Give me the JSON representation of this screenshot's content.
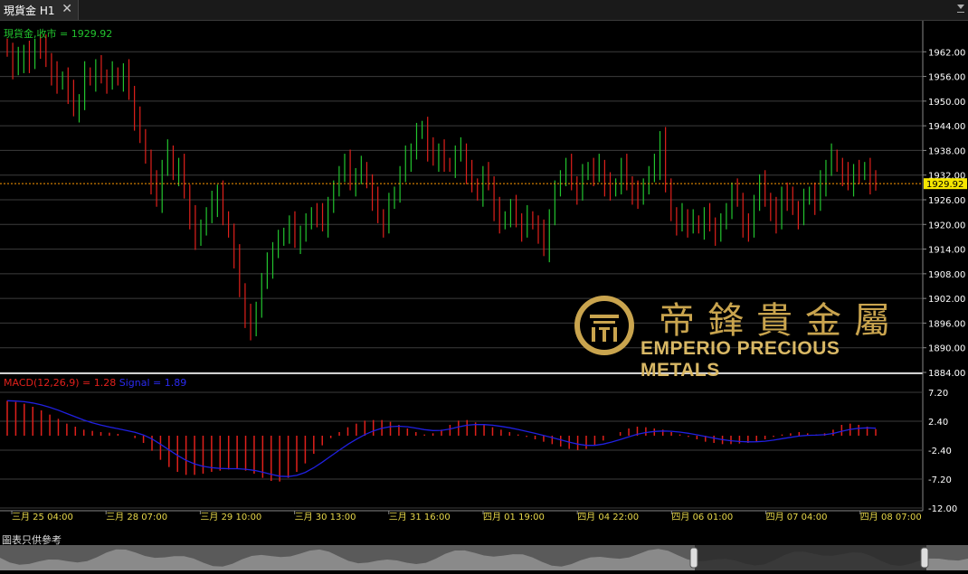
{
  "tab": {
    "title": "現貨金 H1",
    "close": "✕"
  },
  "price_label": "現貨金,收市 = 1929.92",
  "current_price": "1929.92",
  "macd_label": {
    "name": "MACD(12,26,9) = 1.28",
    "signal": "Signal = 1.89"
  },
  "price_axis": [
    "1962.00",
    "1956.00",
    "1950.00",
    "1944.00",
    "1938.00",
    "1932.00",
    "1926.00",
    "1920.00",
    "1914.00",
    "1908.00",
    "1902.00",
    "1896.00",
    "1890.00",
    "1884.00"
  ],
  "macd_axis": [
    "7.20",
    "2.40",
    "-2.40",
    "-7.20",
    "-12.00"
  ],
  "time_axis": [
    "三月 25 04:00",
    "三月 28 07:00",
    "三月 29 10:00",
    "三月 30 13:00",
    "三月 31 16:00",
    "四月 01 19:00",
    "四月 04 22:00",
    "四月 06 01:00",
    "四月 07 04:00",
    "四月 08 07:00"
  ],
  "disclaimer": "圖表只供參考",
  "logo": {
    "cn": "帝鋒貴金屬",
    "en": "EMPERIO PRECIOUS METALS"
  },
  "colors": {
    "up": "#22c32e",
    "down": "#e0201b",
    "signal": "#2020e0",
    "price_line": "#ff9a00",
    "axis_text": "#e8d84a",
    "logo_gold": "#c9a44e"
  },
  "chart_data": {
    "type": "candlestick",
    "price_ylim": [
      1884,
      1968
    ],
    "macd_ylim": [
      -12,
      9.6
    ],
    "closes": [
      1962,
      1958,
      1960,
      1962,
      1959,
      1964,
      1963,
      1960,
      1957,
      1954,
      1956,
      1952,
      1948,
      1950,
      1957,
      1955,
      1958,
      1956,
      1955,
      1957,
      1955,
      1957,
      1952,
      1946,
      1942,
      1936,
      1930,
      1926,
      1934,
      1938,
      1932,
      1934,
      1928,
      1922,
      1916,
      1920,
      1922,
      1925,
      1928,
      1922,
      1918,
      1912,
      1904,
      1898,
      1894,
      1900,
      1906,
      1910,
      1914,
      1916,
      1918,
      1920,
      1916,
      1918,
      1920,
      1923,
      1922,
      1920,
      1925,
      1928,
      1933,
      1935,
      1930,
      1932,
      1934,
      1930,
      1926,
      1922,
      1920,
      1925,
      1928,
      1932,
      1936,
      1938,
      1942,
      1944,
      1938,
      1936,
      1938,
      1935,
      1934,
      1937,
      1938,
      1933,
      1930,
      1927,
      1932,
      1930,
      1924,
      1920,
      1922,
      1924,
      1921,
      1919,
      1922,
      1920,
      1918,
      1914,
      1922,
      1928,
      1932,
      1934,
      1930,
      1928,
      1932,
      1934,
      1932,
      1934,
      1930,
      1928,
      1930,
      1934,
      1930,
      1928,
      1926,
      1930,
      1932,
      1934,
      1941,
      1930,
      1922,
      1920,
      1922,
      1920,
      1921,
      1919,
      1922,
      1920,
      1918,
      1920,
      1924,
      1928,
      1926,
      1920,
      1918,
      1926,
      1930,
      1926,
      1924,
      1920,
      1928,
      1926,
      1924,
      1922,
      1926,
      1928,
      1925,
      1930,
      1934,
      1937,
      1934,
      1932,
      1930,
      1933,
      1932,
      1934,
      1930,
      1929.92
    ],
    "macd_values": [
      5.8,
      5.6,
      5.3,
      4.8,
      4.2,
      3.5,
      2.8,
      2.0,
      1.5,
      1.0,
      0.8,
      0.6,
      0.5,
      0.3,
      0.0,
      -0.4,
      -1.2,
      -2.5,
      -4.0,
      -5.2,
      -6.0,
      -6.5,
      -6.5,
      -6.3,
      -6.0,
      -5.8,
      -5.6,
      -5.5,
      -5.8,
      -6.3,
      -7.0,
      -7.5,
      -7.6,
      -7.0,
      -6.0,
      -4.6,
      -3.0,
      -1.6,
      -0.4,
      0.6,
      1.4,
      2.0,
      2.5,
      2.6,
      2.6,
      2.3,
      1.8,
      1.2,
      0.6,
      0.2,
      0.4,
      1.0,
      1.8,
      2.5,
      2.6,
      2.2,
      1.8,
      1.4,
      1.0,
      0.6,
      0.2,
      -0.2,
      -0.6,
      -1.0,
      -1.4,
      -1.8,
      -2.2,
      -2.4,
      -2.2,
      -1.6,
      -0.8,
      0.0,
      0.6,
      1.2,
      1.5,
      1.4,
      1.2,
      1.0,
      0.6,
      0.2,
      -0.2,
      -0.6,
      -1.0,
      -1.2,
      -1.4,
      -1.4,
      -1.3,
      -1.2,
      -1.0,
      -0.6,
      -0.2,
      0.2,
      0.4,
      0.6,
      0.4,
      0.2,
      0.4,
      1.0,
      1.8,
      2.0,
      1.8,
      1.5,
      1.1
    ]
  }
}
